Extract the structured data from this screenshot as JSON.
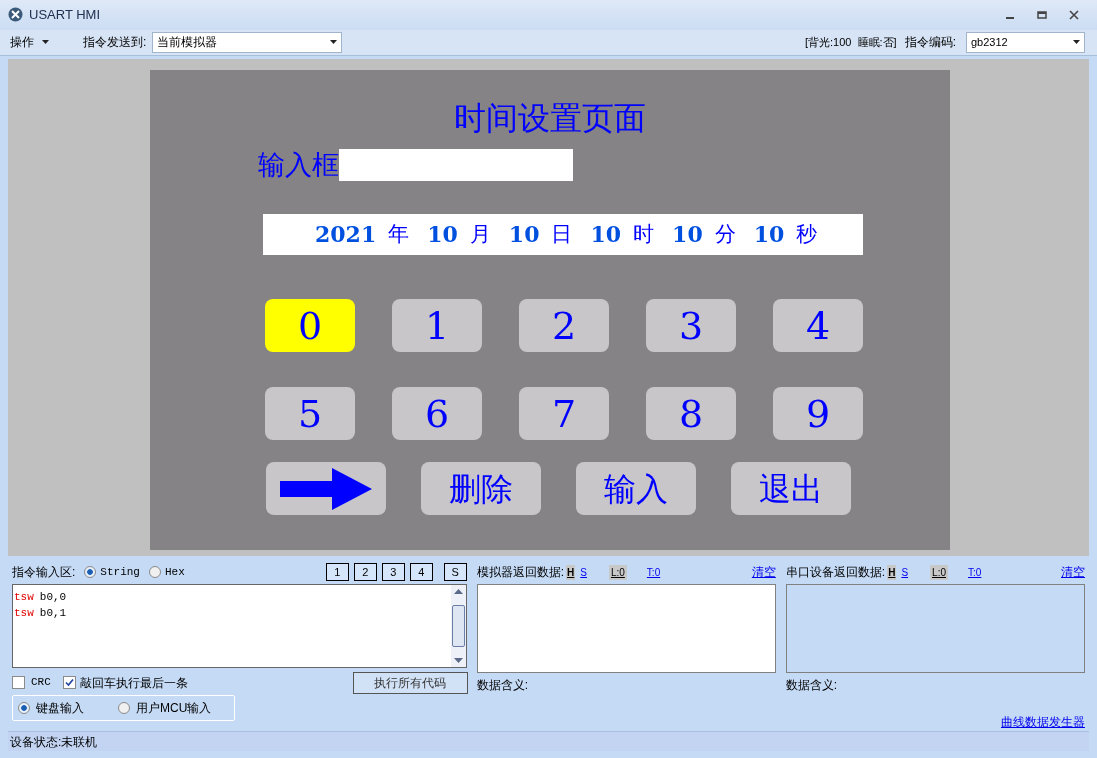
{
  "window": {
    "title": "USART HMI"
  },
  "toolbar": {
    "menu": "操作",
    "send_to_label": "指令发送到:",
    "send_to_value": "当前模拟器",
    "status": "[背光:100  睡眠:否]",
    "encoding_label": "指令编码:",
    "encoding_value": "gb2312"
  },
  "hmi": {
    "title": "时间设置页面",
    "input_label": "输入框",
    "date": [
      {
        "value": "2021",
        "unit": "年"
      },
      {
        "value": "10",
        "unit": "月"
      },
      {
        "value": "10",
        "unit": "日"
      },
      {
        "value": "10",
        "unit": "时"
      },
      {
        "value": "10",
        "unit": "分"
      },
      {
        "value": "10",
        "unit": "秒"
      }
    ],
    "keys": [
      {
        "label": "0",
        "selected": true
      },
      {
        "label": "1",
        "selected": false
      },
      {
        "label": "2",
        "selected": false
      },
      {
        "label": "3",
        "selected": false
      },
      {
        "label": "4",
        "selected": false
      },
      {
        "label": "5",
        "selected": false
      },
      {
        "label": "6",
        "selected": false
      },
      {
        "label": "7",
        "selected": false
      },
      {
        "label": "8",
        "selected": false
      },
      {
        "label": "9",
        "selected": false
      }
    ],
    "actions": [
      {
        "kind": "arrow"
      },
      {
        "kind": "text",
        "label": "删除"
      },
      {
        "kind": "text",
        "label": "输入"
      },
      {
        "kind": "text",
        "label": "退出"
      }
    ]
  },
  "command_area": {
    "label": "指令输入区:",
    "modes": [
      {
        "label": "String",
        "selected": true
      },
      {
        "label": "Hex",
        "selected": false
      }
    ],
    "slots": [
      "1",
      "2",
      "3",
      "4",
      "S"
    ],
    "lines": [
      {
        "keyword": "tsw",
        "args": "b0,0"
      },
      {
        "keyword": "tsw",
        "args": "b0,1"
      }
    ],
    "crc": {
      "label": "CRC",
      "checked": false
    },
    "enter_last": {
      "label": "敲回车执行最后一条",
      "checked": true
    },
    "run_all": "执行所有代码",
    "inputs": [
      {
        "label": "键盘输入",
        "selected": true
      },
      {
        "label": "用户MCU输入",
        "selected": false
      }
    ]
  },
  "return_panels": [
    {
      "label": "模拟器返回数据:",
      "h": "H",
      "s": "S",
      "l": "L:0",
      "t": "T:0",
      "clear": "清空",
      "meaning": "数据含义:",
      "kind": "white"
    },
    {
      "label": "串口设备返回数据:",
      "h": "H",
      "s": "S",
      "l": "L:0",
      "t": "T:0",
      "clear": "清空",
      "meaning": "数据含义:",
      "kind": "blue"
    }
  ],
  "curve_link": "曲线数据发生器",
  "status_bar": "设备状态:未联机"
}
